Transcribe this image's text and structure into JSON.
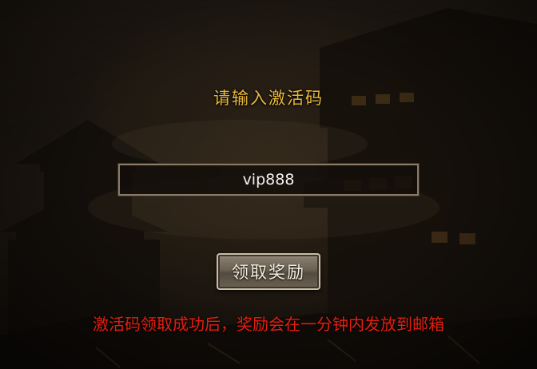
{
  "dialog": {
    "title": "请输入激活码",
    "input_value": "vip888",
    "claim_button_label": "领取奖励",
    "notice": "激活码领取成功后，奖励会在一分钟内发放到邮箱"
  },
  "colors": {
    "title": "#e8b83c",
    "notice": "#e41e10",
    "input_text": "#f2f2f2",
    "button_text": "#f6efe0"
  }
}
